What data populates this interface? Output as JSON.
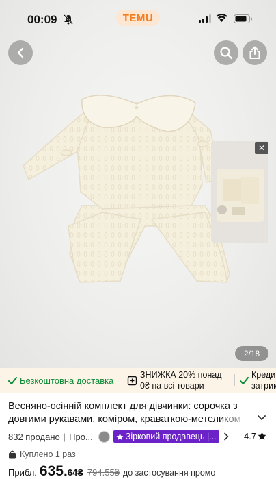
{
  "status_bar": {
    "time": "00:09",
    "app_badge": "TEMU"
  },
  "icons": {
    "back": "chevron-left-icon",
    "search": "search-icon",
    "share": "share-icon",
    "mute": "bell-off-icon",
    "close": "close-icon"
  },
  "gallery": {
    "counter": "2/18",
    "thumb_close": "✕"
  },
  "promo": {
    "free_shipping": "Безкоштовна доставка",
    "discount_line1": "ЗНИЖКА 20% понад",
    "discount_line2": "0₴ на всі товари",
    "credit_line1": "Креди",
    "credit_line2": "затримк"
  },
  "product": {
    "title_line1": "Весняно-осінній комплект для дівчинки: сорочка з",
    "title_line2": "довгими рукавами, коміром, краваткою-метеликом",
    "sold": "832 продано",
    "store_prefix": "Про...",
    "seller_badge": "Зірковий продавець |...",
    "rating": "4.7",
    "bought": "Куплено 1 раз"
  },
  "price": {
    "prefix": "Прибл.",
    "main": "635.",
    "cents": "64₴",
    "old": "794.55₴",
    "note": "до застосування промо"
  },
  "colors": {
    "brand_orange": "#f47d1f",
    "free_shipping_green": "#0b8a36",
    "seller_purple": "#6b22c8",
    "promo_bg": "#fdf4e8"
  }
}
